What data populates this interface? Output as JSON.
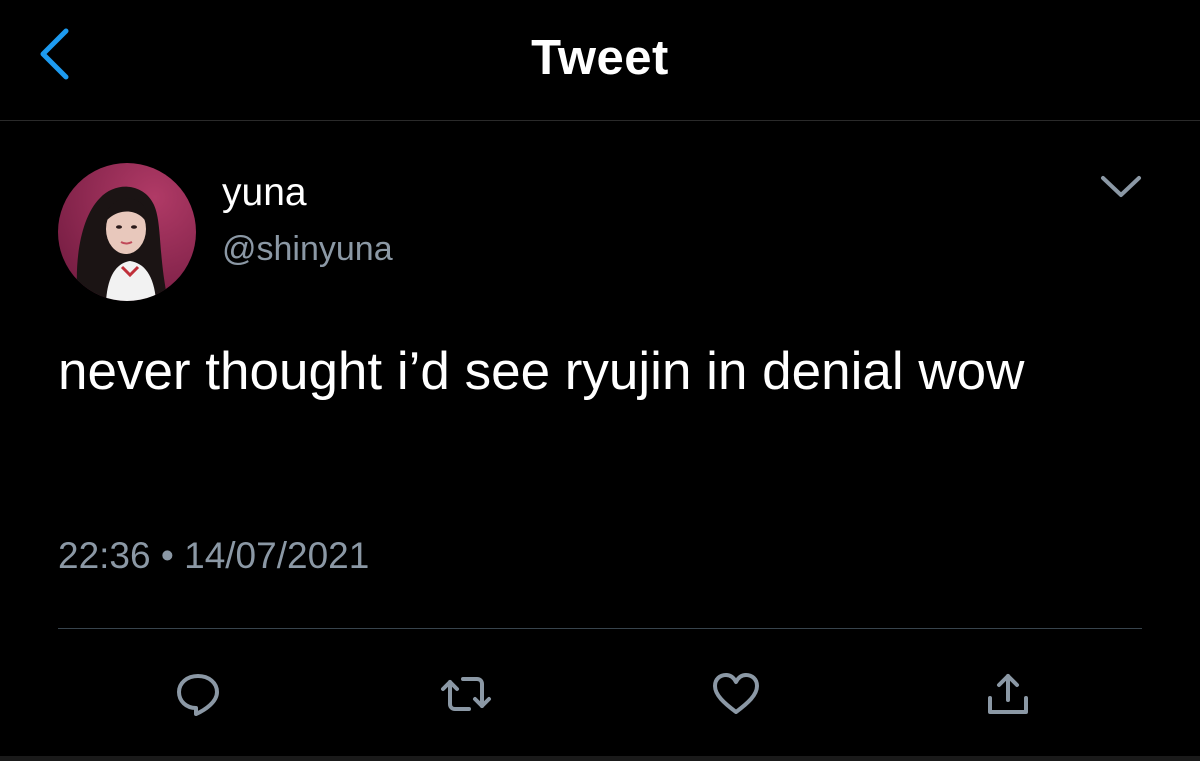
{
  "header": {
    "title": "Tweet",
    "back_icon": "chevron-left-icon",
    "accent_color": "#1d9bf0"
  },
  "tweet": {
    "author": {
      "display_name": "yuna",
      "handle": "@shinyuna",
      "avatar_icon": "profile-photo"
    },
    "text": "never thought i’d see ryujin in denial wow",
    "time": "22:36",
    "separator": "•",
    "date": "14/07/2021",
    "more_icon": "chevron-down-icon"
  },
  "actions": [
    {
      "name": "reply",
      "icon": "reply-icon"
    },
    {
      "name": "retweet",
      "icon": "retweet-icon"
    },
    {
      "name": "like",
      "icon": "heart-icon"
    },
    {
      "name": "share",
      "icon": "share-icon"
    }
  ],
  "colors": {
    "background": "#000000",
    "primary_text": "#ffffff",
    "secondary_text": "#8b98a5",
    "divider": "#38444d"
  }
}
